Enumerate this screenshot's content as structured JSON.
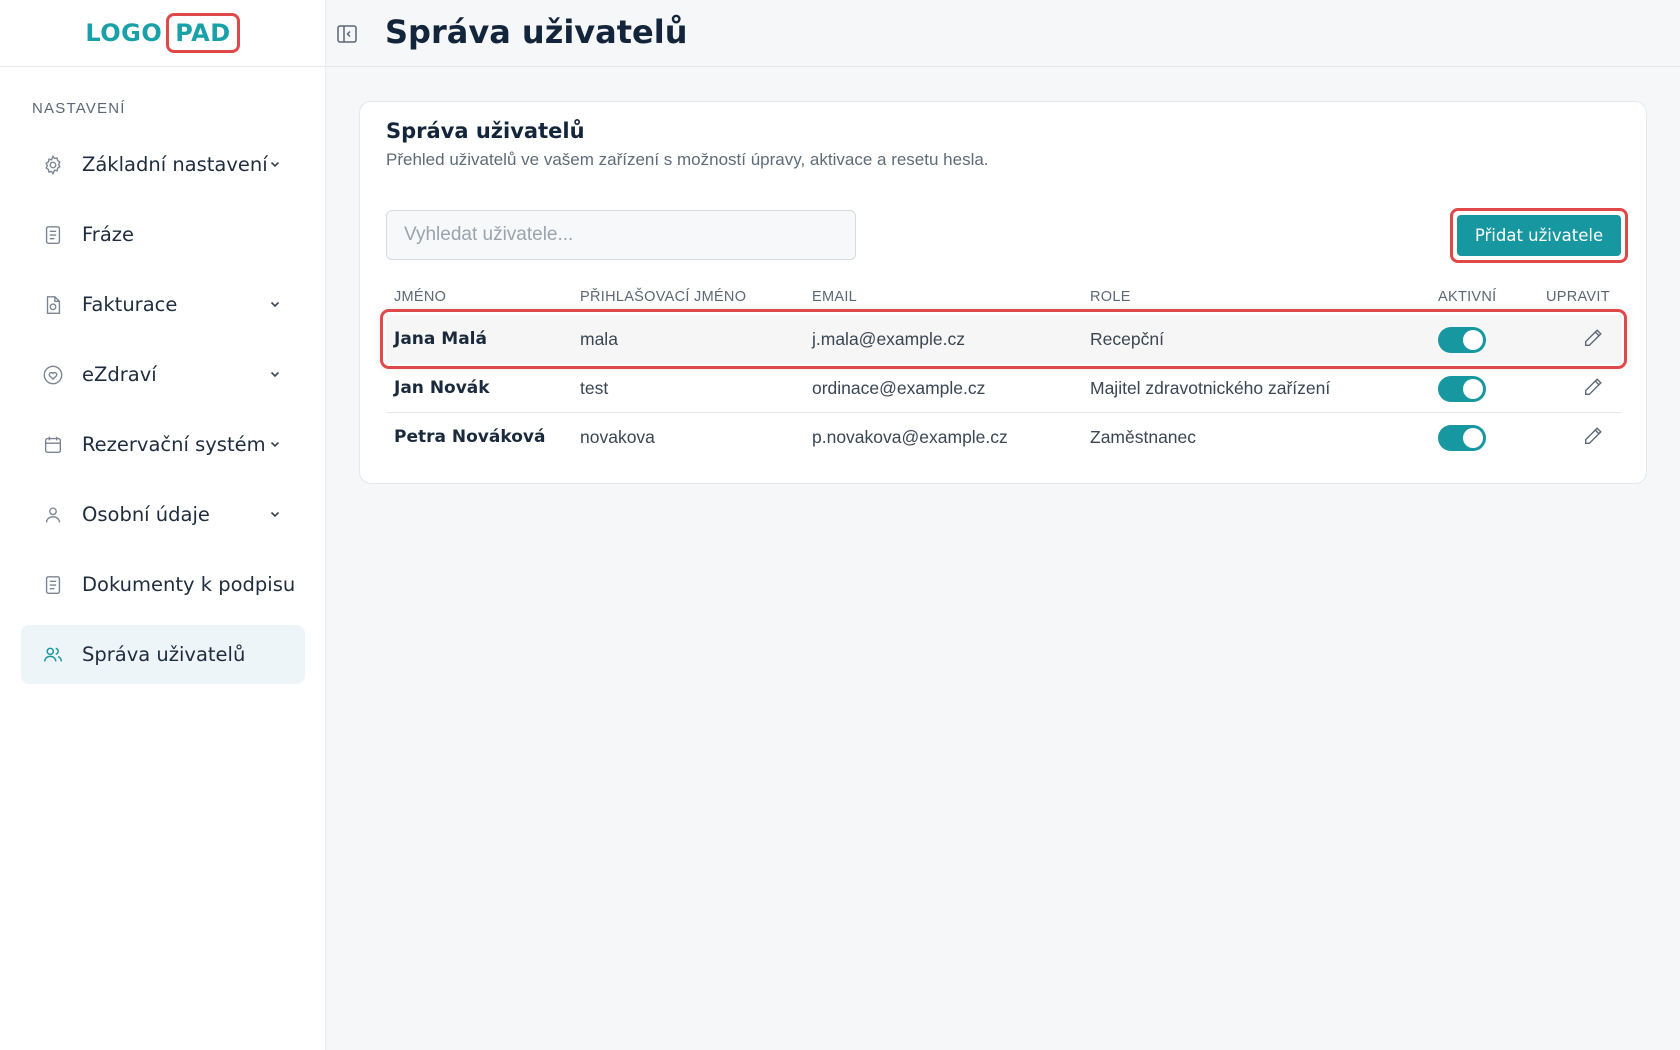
{
  "brand": {
    "logo_left": "LOGO",
    "logo_right": "PAD",
    "accent": "#17979f",
    "highlight": "#e0494a"
  },
  "sidebar": {
    "section_title": "NASTAVENÍ",
    "items": [
      {
        "label": "Základní nastavení",
        "icon": "gear-icon",
        "expandable": true
      },
      {
        "label": "Fráze",
        "icon": "document-icon",
        "expandable": false
      },
      {
        "label": "Fakturace",
        "icon": "invoice-icon",
        "expandable": true
      },
      {
        "label": "eZdraví",
        "icon": "heart-icon",
        "expandable": true
      },
      {
        "label": "Rezervační systém",
        "icon": "calendar-icon",
        "expandable": true
      },
      {
        "label": "Osobní údaje",
        "icon": "user-icon",
        "expandable": true
      },
      {
        "label": "Dokumenty k podpisu",
        "icon": "document-icon",
        "expandable": false
      },
      {
        "label": "Správa uživatelů",
        "icon": "users-icon",
        "expandable": false,
        "active": true
      }
    ]
  },
  "header": {
    "title": "Správa uživatelů"
  },
  "card": {
    "title": "Správa uživatelů",
    "subtitle": "Přehled uživatelů ve vašem zařízení s možností úpravy, aktivace a resetu hesla.",
    "search_placeholder": "Vyhledat uživatele...",
    "add_button": "Přidat uživatele",
    "columns": [
      "JMÉNO",
      "PŘIHLAŠOVACÍ JMÉNO",
      "EMAIL",
      "ROLE",
      "AKTIVNÍ",
      "UPRAVIT"
    ],
    "rows": [
      {
        "name": "Jana Malá",
        "login": "mala",
        "email": "j.mala@example.cz",
        "role": "Recepční",
        "active": true
      },
      {
        "name": "Jan Novák",
        "login": "test",
        "email": "ordinace@example.cz",
        "role": "Majitel zdravotnického zařízení",
        "active": true
      },
      {
        "name": "Petra Nováková",
        "login": "novakova",
        "email": "p.novakova@example.cz",
        "role": "Zaměstnanec",
        "active": true
      }
    ]
  }
}
